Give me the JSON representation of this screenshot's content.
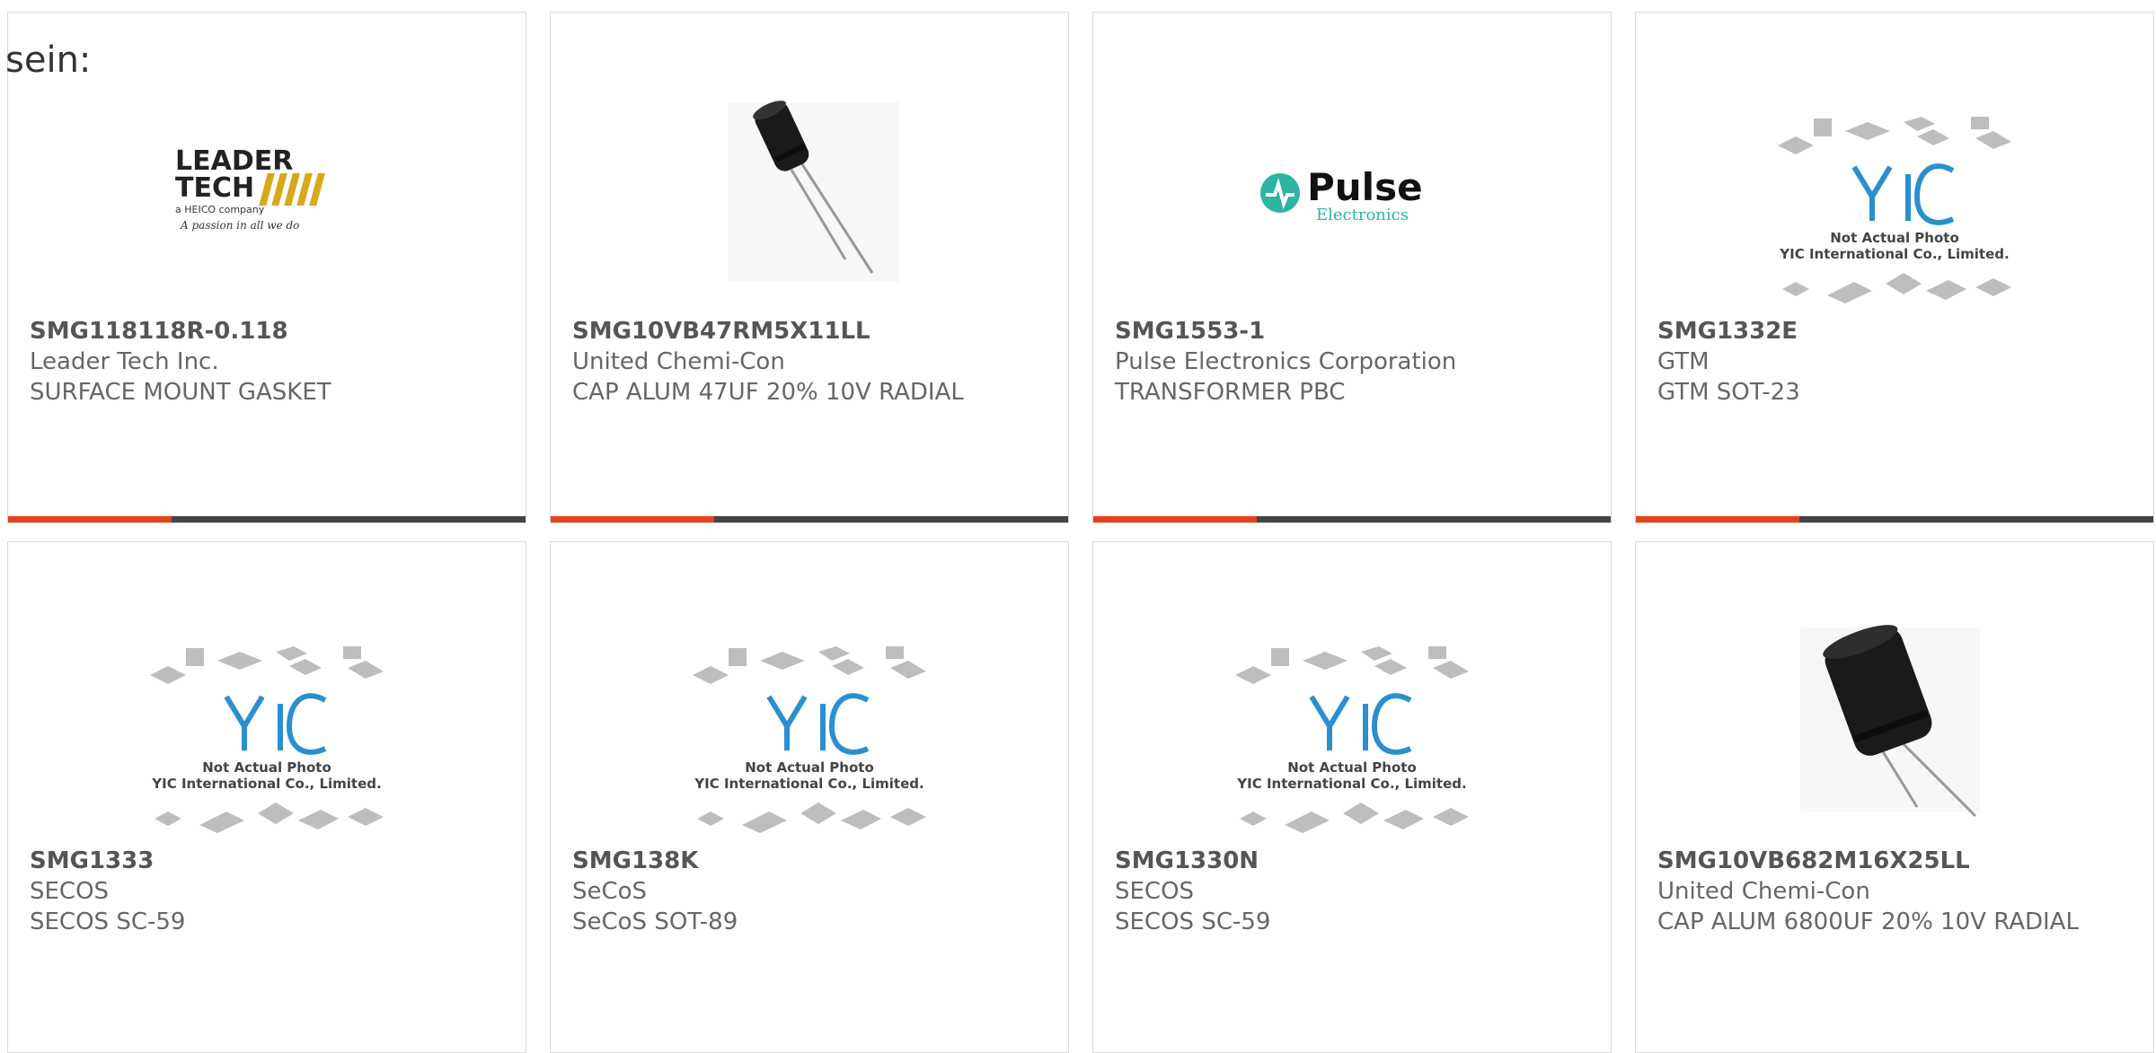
{
  "intro_text": "sein:",
  "colors": {
    "accent": "#e8411a",
    "bar": "#444444",
    "border": "#d8d8d8",
    "text": "#666666"
  },
  "products": [
    {
      "part": "SMG118118R-0.118",
      "maker": "Leader Tech Inc.",
      "desc": "SURFACE MOUNT GASKET",
      "image": "leader-tech-logo",
      "logo_text_1": "LEADER",
      "logo_text_2": "TECH",
      "logo_text_3": "a HEICO company",
      "logo_text_4": "A passion in all we do"
    },
    {
      "part": "SMG10VB47RM5X11LL",
      "maker": "United Chemi-Con",
      "desc": "CAP ALUM 47UF 20% 10V RADIAL",
      "image": "capacitor-small-photo"
    },
    {
      "part": "SMG1553-1",
      "maker": "Pulse Electronics Corporation",
      "desc": "TRANSFORMER PBC",
      "image": "pulse-electronics-logo",
      "logo_text_1": "Pulse",
      "logo_text_2": "Electronics"
    },
    {
      "part": "SMG1332E",
      "maker": "GTM",
      "desc": "GTM SOT-23",
      "image": "yic-placeholder",
      "placeholder_line_1": "Not Actual Photo",
      "placeholder_line_2": "YIC International Co., Limited."
    },
    {
      "part": "SMG1333",
      "maker": "SECOS",
      "desc": "SECOS SC-59",
      "image": "yic-placeholder",
      "placeholder_line_1": "Not Actual Photo",
      "placeholder_line_2": "YIC International Co., Limited."
    },
    {
      "part": "SMG138K",
      "maker": "SeCoS",
      "desc": "SeCoS SOT-89",
      "image": "yic-placeholder",
      "placeholder_line_1": "Not Actual Photo",
      "placeholder_line_2": "YIC International Co., Limited."
    },
    {
      "part": "SMG1330N",
      "maker": "SECOS",
      "desc": "SECOS SC-59",
      "image": "yic-placeholder",
      "placeholder_line_1": "Not Actual Photo",
      "placeholder_line_2": "YIC International Co., Limited."
    },
    {
      "part": "SMG10VB682M16X25LL",
      "maker": "United Chemi-Con",
      "desc": "CAP ALUM 6800UF 20% 10V RADIAL",
      "image": "capacitor-large-photo"
    }
  ]
}
